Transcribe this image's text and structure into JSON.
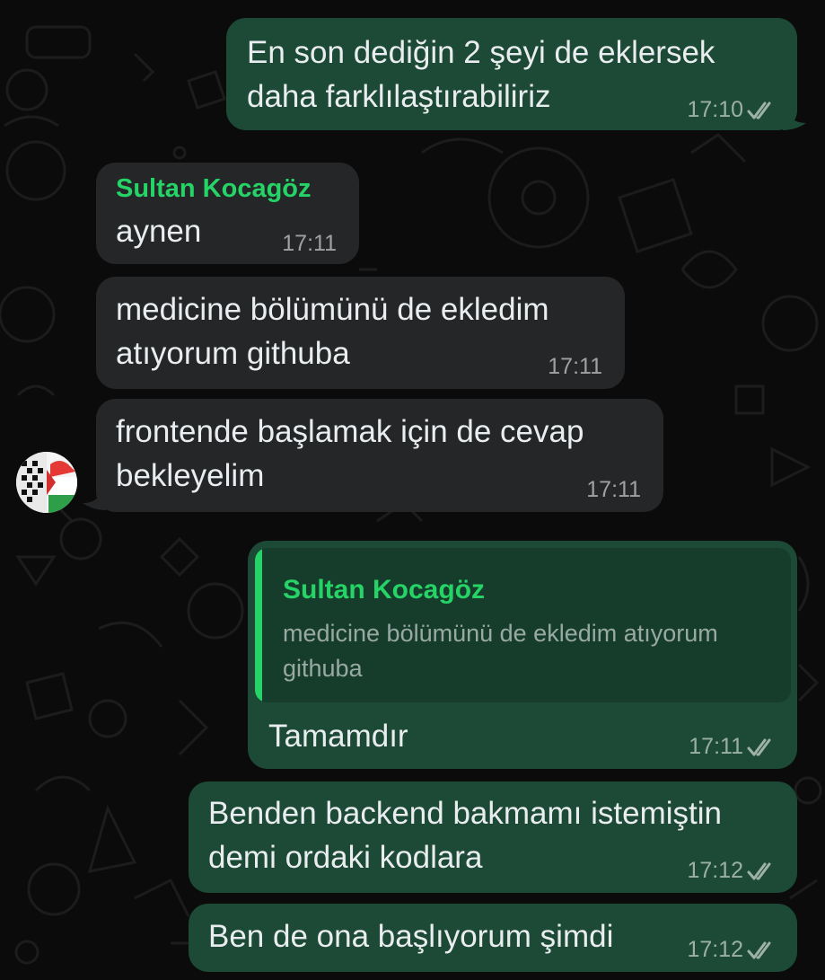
{
  "chat": {
    "messages": [
      {
        "direction": "outgoing",
        "lines": [
          "En son dediğin 2 şeyi de eklersek",
          "daha farklılaştırabiliriz"
        ],
        "time": "17:10",
        "status": "read"
      },
      {
        "direction": "incoming",
        "sender": "Sultan Kocagöz",
        "lines": [
          "aynen"
        ],
        "time": "17:11"
      },
      {
        "direction": "incoming",
        "lines": [
          "medicine bölümünü de ekledim",
          "atıyorum githuba"
        ],
        "time": "17:11"
      },
      {
        "direction": "incoming",
        "lines": [
          "frontende başlamak için de cevap",
          "bekleyelim"
        ],
        "time": "17:11"
      },
      {
        "direction": "outgoing",
        "reply_to": {
          "sender": "Sultan Kocagöz",
          "text": "medicine bölümünü de ekledim atıyorum githuba"
        },
        "lines": [
          "Tamamdır"
        ],
        "time": "17:11",
        "status": "read"
      },
      {
        "direction": "outgoing",
        "lines": [
          "Benden backend bakmamı istemiştin",
          "demi ordaki kodlara"
        ],
        "time": "17:12",
        "status": "read"
      },
      {
        "direction": "outgoing",
        "lines": [
          "Ben de ona başlıyorum şimdi"
        ],
        "time": "17:12",
        "status": "read"
      }
    ]
  },
  "theme": {
    "outgoing_bubble": "#1d4a36",
    "incoming_bubble": "#252627",
    "sender_name": "#25d366",
    "read_check": "#9fb2a9",
    "background": "#0b0b0b"
  },
  "icons": {
    "read_receipt": "double-check-icon",
    "avatar": "contact-avatar"
  }
}
